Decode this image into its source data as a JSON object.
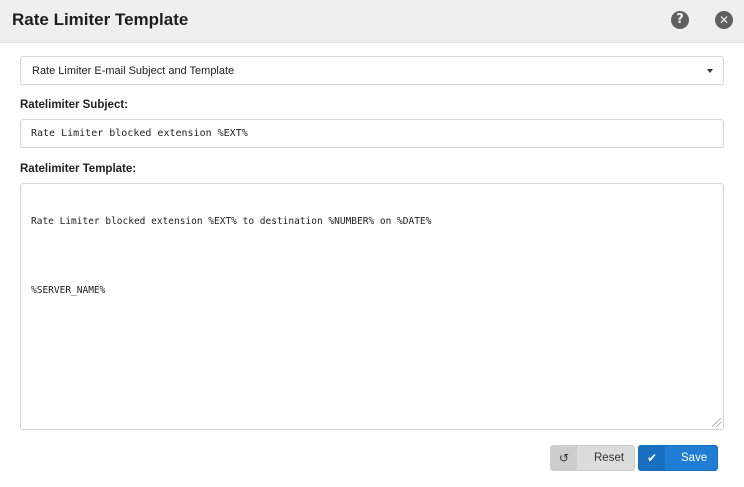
{
  "header": {
    "title": "Rate Limiter Template",
    "help_icon": "question-circle-icon",
    "help_glyph": "?",
    "close_icon": "close-circle-icon",
    "close_glyph": "✕"
  },
  "template_select": {
    "selected": "Rate Limiter E-mail Subject and Template"
  },
  "subject": {
    "label": "Ratelimiter Subject:",
    "value": "Rate Limiter blocked extension %EXT%"
  },
  "template": {
    "label": "Ratelimiter Template:",
    "lines": [
      "Rate Limiter blocked extension %EXT% to destination %NUMBER% on %DATE%",
      "",
      "%SERVER_NAME%"
    ]
  },
  "actions": {
    "reset_label": "Reset",
    "reset_icon": "undo-icon",
    "reset_glyph": "↺",
    "save_label": "Save",
    "save_icon": "check-icon",
    "save_glyph": "✔",
    "save_color": "#1f7ed4"
  }
}
